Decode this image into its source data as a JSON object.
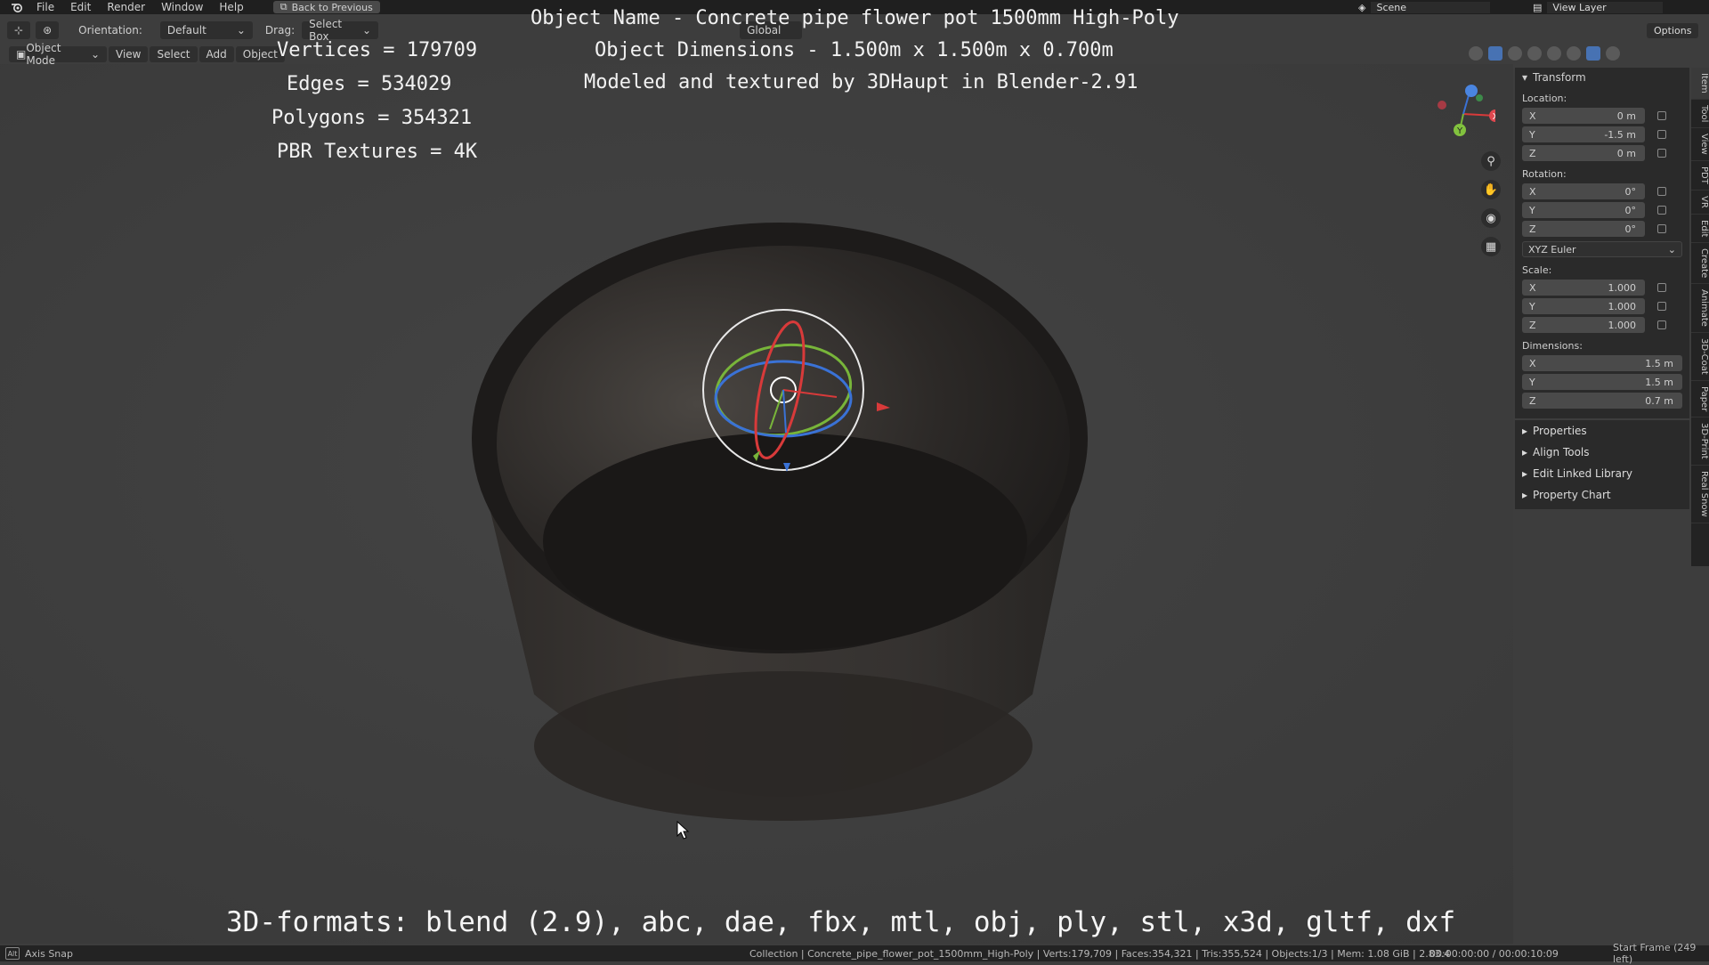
{
  "topbar": {
    "menus": [
      "File",
      "Edit",
      "Render",
      "Window",
      "Help"
    ],
    "back_button": "Back to Previous",
    "scene": "Scene",
    "view_layer": "View Layer"
  },
  "header": {
    "orientation_label": "Orientation:",
    "orientation_value": "Default",
    "drag_label": "Drag:",
    "drag_value": "Select Box",
    "transform_space": "Global",
    "options": "Options",
    "mode": "Object Mode",
    "menus": [
      "View",
      "Select",
      "Add",
      "Object"
    ]
  },
  "overlay": {
    "stats": [
      "Vertices = 179709",
      "Edges = 534029",
      "Polygons = 354321",
      "PBR Textures = 4K"
    ],
    "info": [
      "Object Name - Concrete pipe flower pot 1500mm High-Poly",
      "Object Dimensions -  1.500m x 1.500m x 0.700m",
      "Modeled and textured by 3DHaupt in Blender-2.91"
    ],
    "formats": "3D-formats: blend (2.9), abc, dae, fbx, mtl, obj, ply, stl, x3d, gltf, dxf"
  },
  "npanel": {
    "transform": "Transform",
    "location_label": "Location:",
    "location": [
      {
        "axis": "X",
        "value": "0 m"
      },
      {
        "axis": "Y",
        "value": "-1.5 m"
      },
      {
        "axis": "Z",
        "value": "0 m"
      }
    ],
    "rotation_label": "Rotation:",
    "rotation": [
      {
        "axis": "X",
        "value": "0°"
      },
      {
        "axis": "Y",
        "value": "0°"
      },
      {
        "axis": "Z",
        "value": "0°"
      }
    ],
    "rotation_mode": "XYZ Euler",
    "scale_label": "Scale:",
    "scale": [
      {
        "axis": "X",
        "value": "1.000"
      },
      {
        "axis": "Y",
        "value": "1.000"
      },
      {
        "axis": "Z",
        "value": "1.000"
      }
    ],
    "dimensions_label": "Dimensions:",
    "dimensions": [
      {
        "axis": "X",
        "value": "1.5 m"
      },
      {
        "axis": "Y",
        "value": "1.5 m"
      },
      {
        "axis": "Z",
        "value": "0.7 m"
      }
    ],
    "subpanels": [
      "Properties",
      "Align Tools",
      "Edit Linked Library",
      "Property Chart"
    ]
  },
  "vtabs": [
    "Item",
    "Tool",
    "View",
    "PDT",
    "VR",
    "Edit",
    "Create",
    "Animate",
    "3D-Coat",
    "Paper",
    "3D-Print",
    "Real Snow"
  ],
  "gizmo": {
    "x_label": "X",
    "y_label": "Y"
  },
  "status": {
    "key": "Alt",
    "left": "Axis Snap",
    "info": "Collection | Concrete_pipe_flower_pot_1500mm_High-Poly | Verts:179,709 | Faces:354,321 | Tris:355,524 | Objects:1/3 | Mem: 1.08 GiB | 2.83.4",
    "time": "00:00:00:00 / 00:00:10:09",
    "frame": "Start Frame (249 left)"
  }
}
